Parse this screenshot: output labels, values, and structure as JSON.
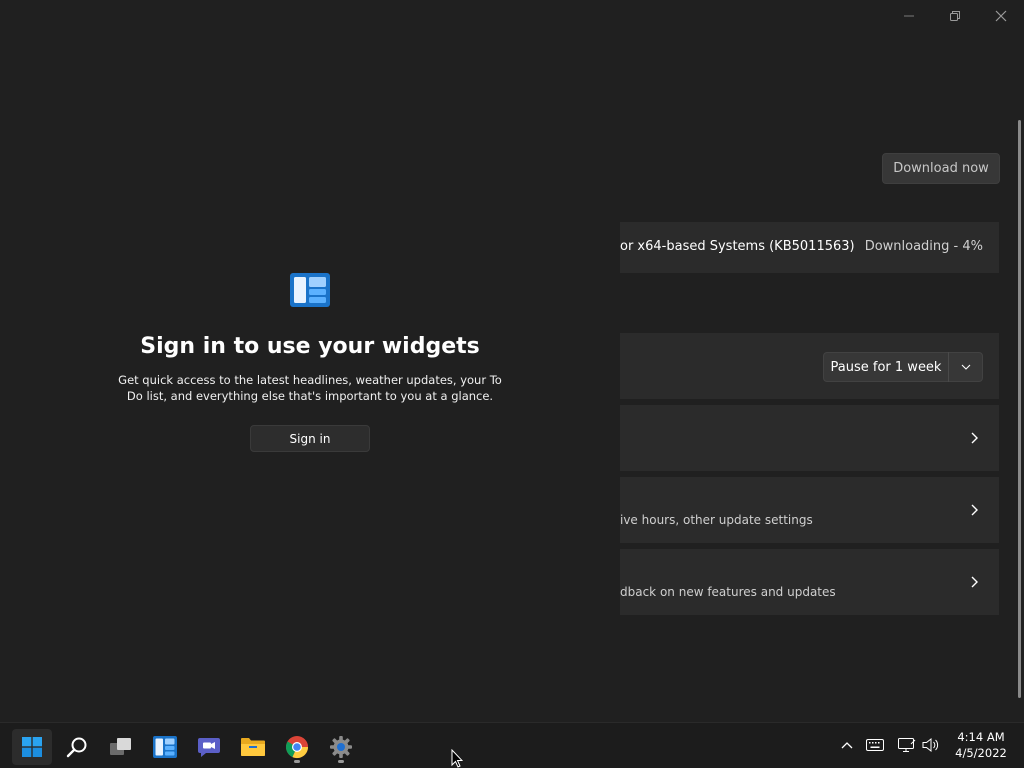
{
  "window": {
    "minimize_icon": "minimize-icon",
    "maximize_icon": "restore-icon",
    "close_icon": "close-icon"
  },
  "windows_update": {
    "download_button_label": "Download now",
    "update_name": "or x64-based Systems (KB5011563)",
    "update_status": "Downloading - 4%",
    "pause_dropdown_value": "Pause for 1 week",
    "advanced_subtitle": "ive hours, other update settings",
    "insider_subtitle": "dback on new features and updates"
  },
  "widgets": {
    "title": "Sign in to use your widgets",
    "description": "Get quick access to the latest headlines, weather updates, your To Do list, and everything else that's important to you at a glance.",
    "signin_label": "Sign in"
  },
  "taskbar": {
    "apps": [
      {
        "name": "start",
        "icon": "windows-logo-icon"
      },
      {
        "name": "search",
        "icon": "search-icon"
      },
      {
        "name": "task-view",
        "icon": "task-view-icon"
      },
      {
        "name": "widgets",
        "icon": "widgets-icon"
      },
      {
        "name": "chat",
        "icon": "teams-chat-icon"
      },
      {
        "name": "file-explorer",
        "icon": "folder-icon"
      },
      {
        "name": "chrome",
        "icon": "chrome-icon"
      },
      {
        "name": "settings",
        "icon": "gear-icon"
      }
    ],
    "clock_time": "4:14 AM",
    "clock_date": "4/5/2022"
  },
  "colors": {
    "background": "#202020",
    "card": "#2b2b2b",
    "taskbar": "#1c1c1c",
    "accent_blue": "#0078d4"
  }
}
